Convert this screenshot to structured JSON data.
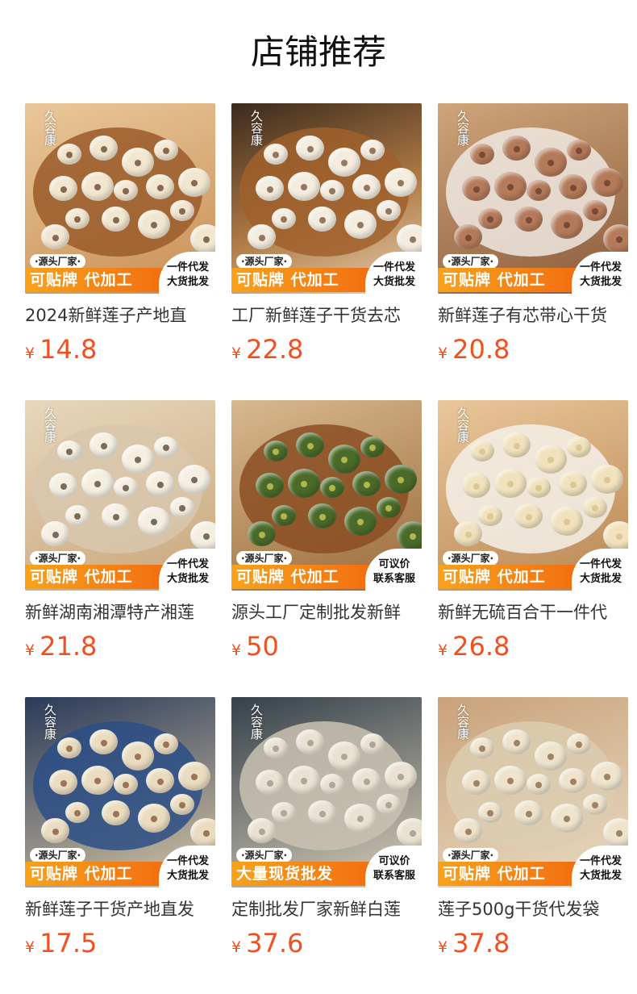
{
  "page": {
    "title": "店铺推荐"
  },
  "currency": "¥",
  "products": [
    {
      "title": "2024新鲜莲子产地直",
      "price": "14.8",
      "source_tag": "·源头厂家·",
      "promo": "可贴牌 代加工",
      "badge": [
        "一件代发",
        "大货批发"
      ],
      "logo": "久容康"
    },
    {
      "title": "工厂新鲜莲子干货去芯",
      "price": "22.8",
      "source_tag": "·源头厂家·",
      "promo": "可贴牌 代加工",
      "badge": [
        "一件代发",
        "大货批发"
      ],
      "logo": "久容康"
    },
    {
      "title": "新鲜莲子有芯带心干货",
      "price": "20.8",
      "source_tag": "·源头厂家·",
      "promo": "可贴牌 代加工",
      "badge": [
        "一件代发",
        "大货批发"
      ],
      "logo": "久容康"
    },
    {
      "title": "新鲜湖南湘潭特产湘莲",
      "price": "21.8",
      "source_tag": "·源头厂家·",
      "promo": "可贴牌 代加工",
      "badge": [
        "一件代发",
        "大货批发"
      ],
      "logo": "久容康"
    },
    {
      "title": "源头工厂定制批发新鲜",
      "price": "50",
      "source_tag": "·源头厂家·",
      "promo": "可贴牌 代加工",
      "badge": [
        "可议价",
        "联系客服"
      ],
      "logo": ""
    },
    {
      "title": "新鲜无硫百合干一件代",
      "price": "26.8",
      "source_tag": "·源头厂家·",
      "promo": "可贴牌 代加工",
      "badge": [
        "一件代发",
        "大货批发"
      ],
      "logo": "久容康"
    },
    {
      "title": "新鲜莲子干货产地直发",
      "price": "17.5",
      "source_tag": "·源头厂家·",
      "promo": "可贴牌 代加工",
      "badge": [
        "一件代发",
        "大货批发"
      ],
      "logo": "久容康"
    },
    {
      "title": "定制批发厂家新鲜白莲",
      "price": "37.6",
      "source_tag": "·源头厂家·",
      "promo": "大量现货批发",
      "badge": [
        "可议价",
        "联系客服"
      ],
      "logo": "久容康"
    },
    {
      "title": "莲子500g干货代发袋",
      "price": "37.8",
      "source_tag": "·源头厂家·",
      "promo": "可贴牌 代加工",
      "badge": [
        "一件代发",
        "大货批发"
      ],
      "logo": "久容康"
    }
  ]
}
